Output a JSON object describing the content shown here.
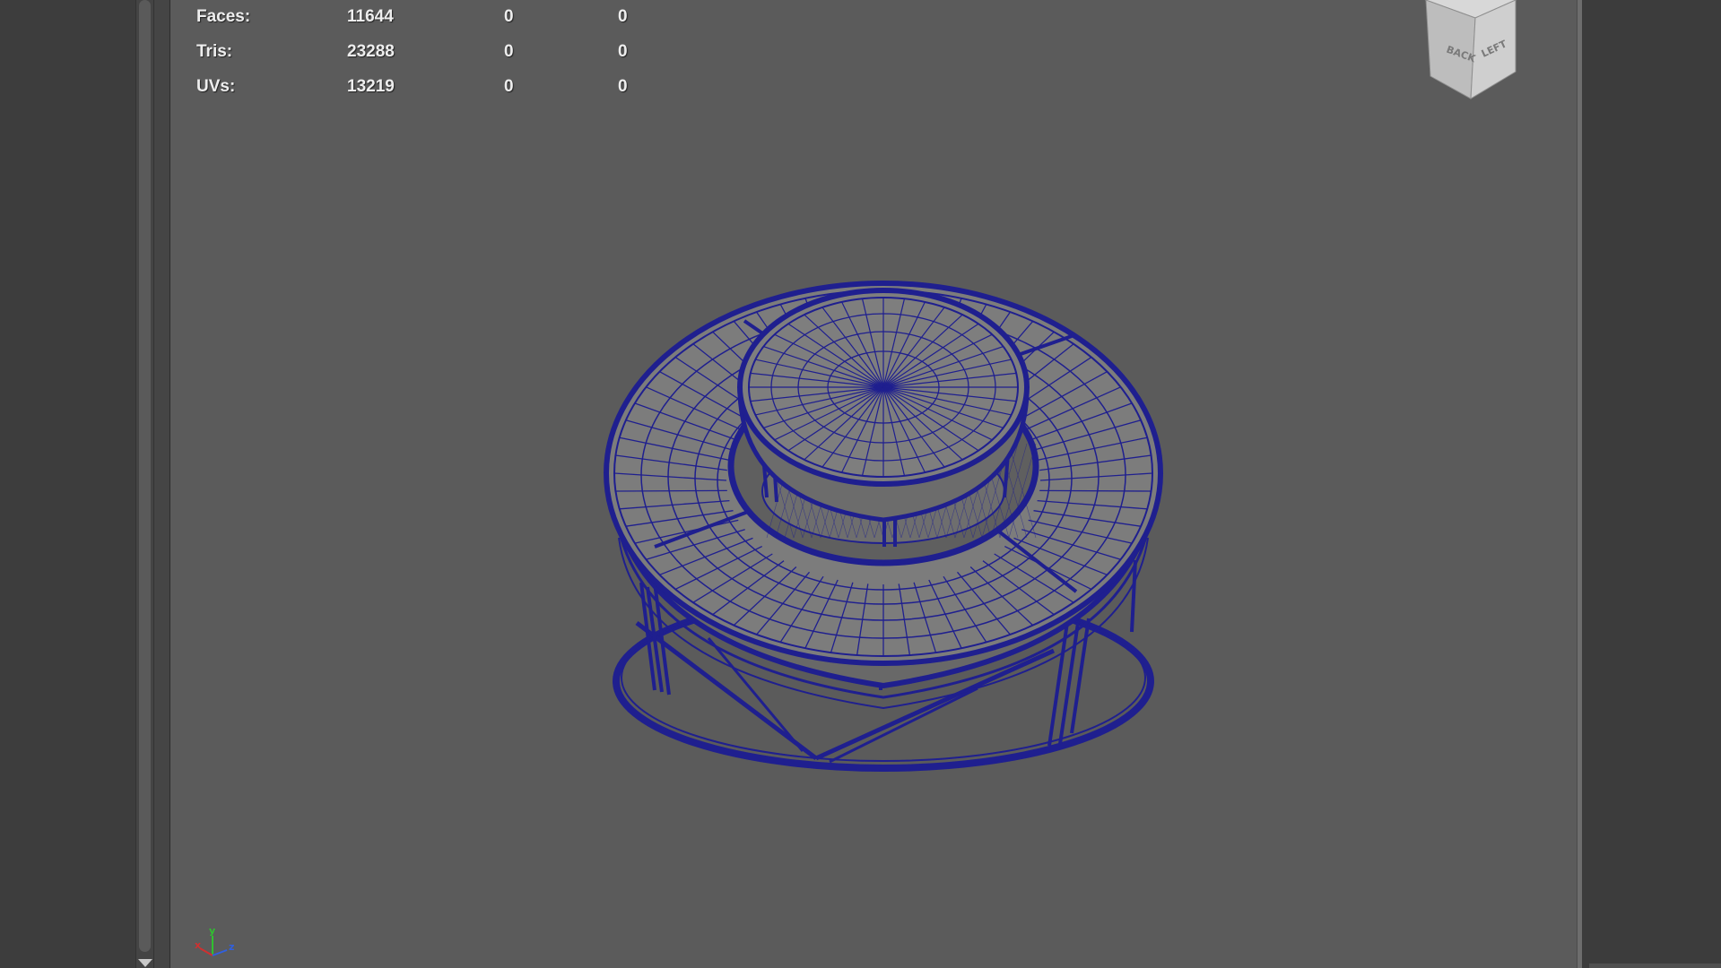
{
  "hud": {
    "rows": [
      {
        "label": "Faces:",
        "values": [
          "11644",
          "0",
          "0"
        ]
      },
      {
        "label": "Tris:",
        "values": [
          "23288",
          "0",
          "0"
        ]
      },
      {
        "label": "UVs:",
        "values": [
          "13219",
          "0",
          "0"
        ]
      }
    ]
  },
  "view_cube": {
    "faces": [
      "BACK",
      "LEFT"
    ]
  },
  "axis_indicator": {
    "x": "x",
    "y": "y",
    "z": "z"
  },
  "colors": {
    "viewport_bg": "#5b5b5b",
    "wireframe": "#1f1f8f",
    "surface": "#7a7a7a",
    "axis_x": "#d03030",
    "axis_y": "#30c030",
    "axis_z": "#3060e0"
  },
  "icons": {
    "view_cube": "view-cube-icon",
    "axis": "axis-gizmo-icon",
    "scroll_down": "triangle-down-icon"
  }
}
